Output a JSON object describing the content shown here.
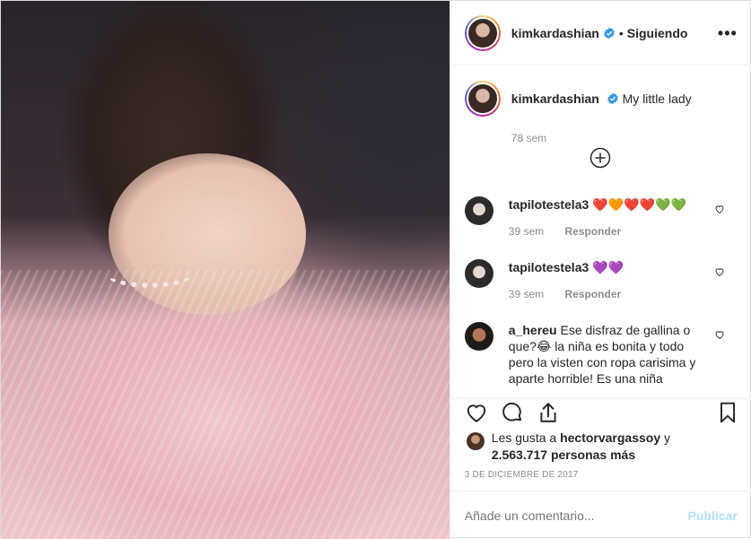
{
  "photo": {
    "alt": ""
  },
  "header": {
    "username": "kimkardashian",
    "separator": "•",
    "follow_label": "Siguiendo",
    "more_label": "•••"
  },
  "caption": {
    "username": "kimkardashian",
    "text": "My little lady",
    "time": "78 sem"
  },
  "comments": [
    {
      "username": "tapilotestela3",
      "text": "❤️🧡❤️❤️💚💚",
      "time": "39 sem",
      "reply_label": "Responder"
    },
    {
      "username": "tapilotestela3",
      "text": "💜💜",
      "time": "39 sem",
      "reply_label": "Responder"
    },
    {
      "username": "a_hereu",
      "text": "Ese disfraz de gallina o que?😂 la niña es bonita y todo pero la visten con ropa carisima y aparte horrible! Es una niña",
      "time": "",
      "reply_label": ""
    }
  ],
  "likes": {
    "prefix": "Les gusta a",
    "user": "hectorvargassoy",
    "joiner": "y",
    "count": "2.563.717 personas más"
  },
  "date": "3 DE DICIEMBRE DE 2017",
  "add_comment": {
    "placeholder": "Añade un comentario...",
    "post_label": "Publicar"
  },
  "colors": {
    "verified": "#3897f0",
    "post_button_disabled": "#b2dffc",
    "secondary_text": "#8e8e8e"
  },
  "icons": [
    "verified-badge-icon",
    "more-options-icon",
    "load-more-comments-icon",
    "heart-icon",
    "comment-icon",
    "share-icon",
    "bookmark-icon"
  ]
}
